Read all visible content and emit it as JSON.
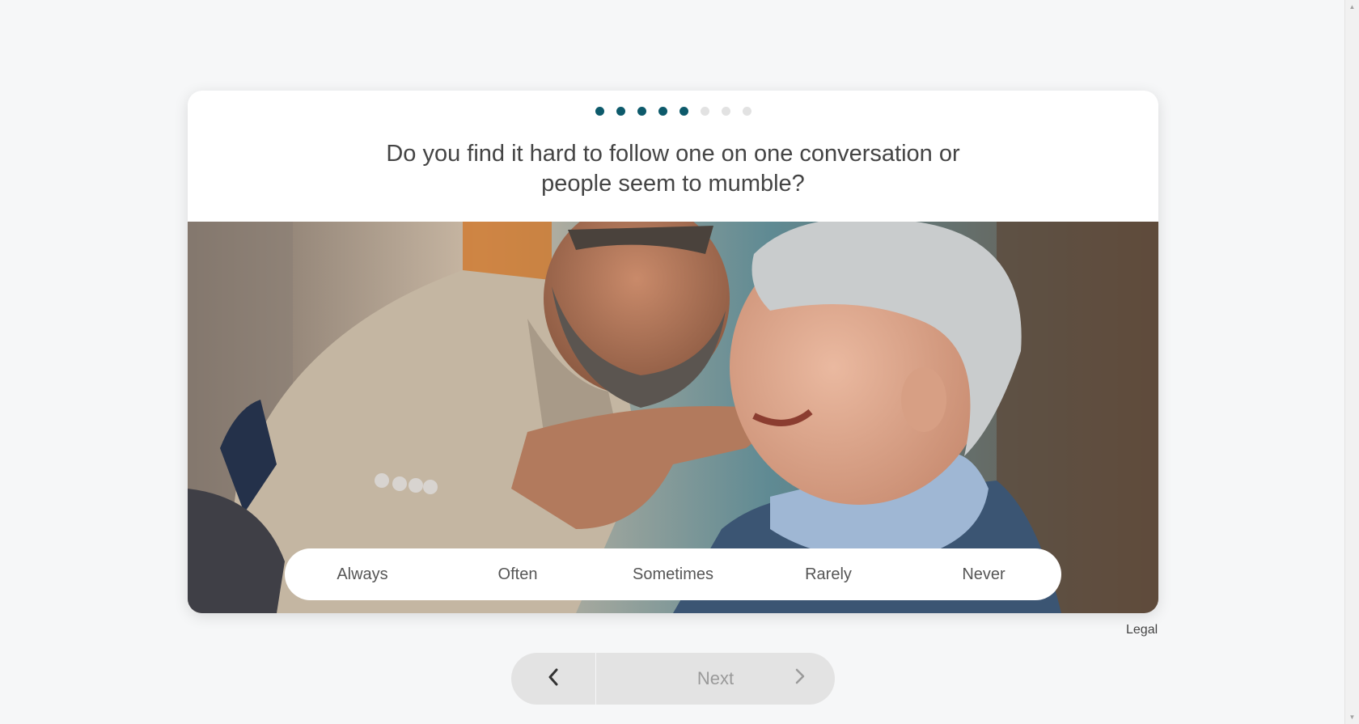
{
  "progress": {
    "total_steps": 8,
    "current_step": 5
  },
  "question": {
    "line1": "Do you find it hard to follow one on one conversation or",
    "line2": "people seem to mumble?"
  },
  "answers": [
    "Always",
    "Often",
    "Sometimes",
    "Rarely",
    "Never"
  ],
  "legal_label": "Legal",
  "navigation": {
    "back_icon": "chevron-left-icon",
    "next_label": "Next",
    "next_icon": "chevron-right-icon"
  },
  "colors": {
    "accent": "#0d5a6b",
    "inactive_dot": "#e2e2e2",
    "disabled_button": "#e3e3e3"
  }
}
